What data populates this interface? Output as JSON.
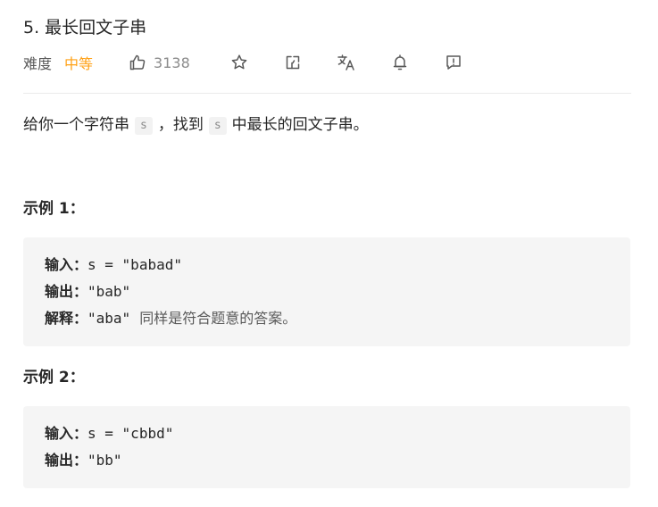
{
  "problem": {
    "title": "5. 最长回文子串",
    "difficulty_label": "难度",
    "difficulty_value": "中等",
    "difficulty_color": "#ffa116",
    "likes": "3138"
  },
  "toolbar": {
    "icons": [
      "thumbs-up-icon",
      "star-icon",
      "share-icon",
      "translate-icon",
      "bell-icon",
      "feedback-icon"
    ]
  },
  "description": {
    "part1": "给你一个字符串",
    "code1": "s",
    "part2": "，找到",
    "code2": "s",
    "part3": "中最长的回文子串。"
  },
  "example1": {
    "title": "示例 1：",
    "input_label": "输入：",
    "input_value": "s = \"babad\"",
    "output_label": "输出：",
    "output_value": "\"bab\"",
    "explain_label": "解释：",
    "explain_value": "\"aba\"",
    "explain_note": "同样是符合题意的答案。"
  },
  "example2": {
    "title": "示例 2：",
    "input_label": "输入：",
    "input_value": "s = \"cbbd\"",
    "output_label": "输出：",
    "output_value": "\"bb\""
  }
}
